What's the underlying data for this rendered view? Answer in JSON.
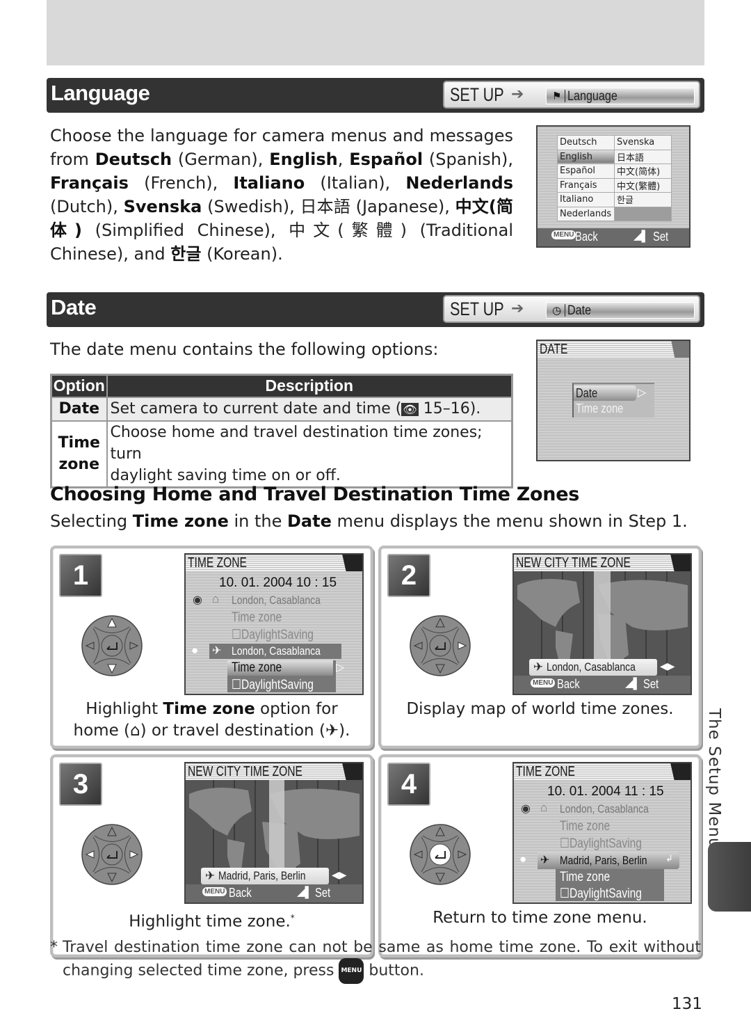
{
  "language_section": {
    "title": "Language",
    "breadcrumb": {
      "root": "SET UP",
      "icon": "flag-icon",
      "item": "Language"
    },
    "body_parts": [
      {
        "t": "Choose the language for camera menus and messages from ",
        "b": false
      },
      {
        "t": "Deutsch",
        "b": true
      },
      {
        "t": " (German), ",
        "b": false
      },
      {
        "t": "English",
        "b": true
      },
      {
        "t": ", ",
        "b": false
      },
      {
        "t": "Español",
        "b": true
      },
      {
        "t": " (Spanish), ",
        "b": false
      },
      {
        "t": "Français",
        "b": true
      },
      {
        "t": " (French), ",
        "b": false
      },
      {
        "t": "Italiano",
        "b": true
      },
      {
        "t": " (Italian), ",
        "b": false
      },
      {
        "t": "Nederlands",
        "b": true
      },
      {
        "t": " (Dutch), ",
        "b": false
      },
      {
        "t": "Svenska",
        "b": true
      },
      {
        "t": " (Swedish), 日本語 (Japanese), ",
        "b": false
      },
      {
        "t": "中文(简体)",
        "b": true
      },
      {
        "t": " (Simplified Chinese), 中文(繁體) (Traditional Chinese), and ",
        "b": false
      },
      {
        "t": "한글",
        "b": true
      },
      {
        "t": " (Korean).",
        "b": false
      }
    ],
    "screen": {
      "rows": [
        [
          "Deutsch",
          "Svenska"
        ],
        [
          "English",
          "日本語"
        ],
        [
          "Español",
          "中文(简体)"
        ],
        [
          "Français",
          "中文(繁體)"
        ],
        [
          "Italiano",
          "한글"
        ],
        [
          "Nederlands",
          ""
        ]
      ],
      "selected": "English",
      "menu_chip": "MENU",
      "back": "Back",
      "set": "Set"
    }
  },
  "date_section": {
    "title": "Date",
    "breadcrumb": {
      "root": "SET UP",
      "icon": "clock-icon",
      "item": "Date"
    },
    "intro": "The date menu contains the following options:",
    "table": {
      "headers": [
        "Option",
        "Description"
      ],
      "rows": [
        {
          "option": "Date",
          "description": "Set camera to current date and time (",
          "ref": "15–16)."
        },
        {
          "option_line1": "Time",
          "option_line2": "zone",
          "line1": "Choose home and travel destination time zones; turn",
          "line2": "daylight saving time on or off."
        }
      ]
    },
    "screen": {
      "title": "DATE",
      "items": [
        "Date",
        "Time zone"
      ],
      "selected": "Date"
    }
  },
  "timezones": {
    "heading": "Choosing Home and Travel Destination Time Zones",
    "intro_parts": [
      {
        "t": "Selecting ",
        "b": false
      },
      {
        "t": "Time zone",
        "b": true
      },
      {
        "t": " in the ",
        "b": false
      },
      {
        "t": "Date",
        "b": true
      },
      {
        "t": " menu displays the menu shown in Step 1.",
        "b": false
      }
    ],
    "steps": [
      {
        "number": "1",
        "screen_title": "TIME ZONE",
        "datetime": "10. 01. 2004  10 : 15",
        "home_city": "London, Casablanca",
        "travel_city": "London, Casablanca",
        "time_zone": "Time zone",
        "daylight": "DaylightSaving",
        "caption_l1_a": "Highlight ",
        "caption_l1_b": "Time zone",
        "caption_l1_c": " option for",
        "caption_l2": "home (⌂) or travel destination (✈)."
      },
      {
        "number": "2",
        "screen_title": "NEW CITY TIME ZONE",
        "city": "London, Casablanca",
        "back": "Back",
        "set": "Set",
        "caption": "Display map of world time zones."
      },
      {
        "number": "3",
        "screen_title": "NEW CITY TIME ZONE",
        "city": "Madrid, Paris, Berlin",
        "back": "Back",
        "set": "Set",
        "caption": "Highlight time zone.",
        "caption_mark": "*"
      },
      {
        "number": "4",
        "screen_title": "TIME ZONE",
        "datetime": "10. 01. 2004  11 : 15",
        "home_city": "London, Casablanca",
        "travel_city": "Madrid, Paris, Berlin",
        "time_zone": "Time zone",
        "daylight": "DaylightSaving",
        "caption": "Return to time zone menu."
      }
    ],
    "footnote_l1": "Travel destination time zone can not be same as home time zone.  To exit without",
    "footnote_l2a": "changing selected time zone, press ",
    "footnote_l2b": " button.",
    "footnote_mark": "*"
  },
  "side_tab": "The Setup Menu",
  "page_number": "131"
}
